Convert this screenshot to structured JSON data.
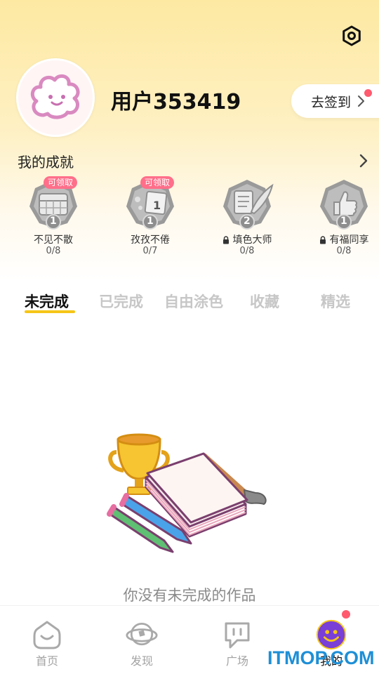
{
  "header": {
    "settings_icon": "gear-icon",
    "username": "用户353419",
    "checkin_label": "去签到"
  },
  "achievements": {
    "title": "我的成就",
    "badges": [
      {
        "name": "不见不散",
        "progress": "0/8",
        "level": "1",
        "tag": "可领取",
        "locked": false
      },
      {
        "name": "孜孜不倦",
        "progress": "0/7",
        "level": "1",
        "tag": "可领取",
        "locked": false
      },
      {
        "name": "填色大师",
        "progress": "0/8",
        "level": "2",
        "tag": "",
        "locked": true
      },
      {
        "name": "有福同享",
        "progress": "0/8",
        "level": "1",
        "tag": "",
        "locked": true
      }
    ]
  },
  "tabs": [
    {
      "label": "未完成",
      "active": true
    },
    {
      "label": "已完成",
      "active": false
    },
    {
      "label": "自由涂色",
      "active": false
    },
    {
      "label": "收藏",
      "active": false
    },
    {
      "label": "精选",
      "active": false
    }
  ],
  "empty_state": {
    "message": "你没有未完成的作品"
  },
  "bottom_nav": [
    {
      "label": "首页",
      "icon": "home-icon",
      "active": false
    },
    {
      "label": "发现",
      "icon": "planet-icon",
      "active": false
    },
    {
      "label": "广场",
      "icon": "chat-icon",
      "active": false
    },
    {
      "label": "我的",
      "icon": "profile-face-icon",
      "active": true
    }
  ],
  "watermark": "ITMOP.COM",
  "colors": {
    "accent_yellow": "#f5c518",
    "badge_tag": "#ff6f8a",
    "notification_dot": "#ff5a6e",
    "watermark": "#1e8fd6"
  }
}
